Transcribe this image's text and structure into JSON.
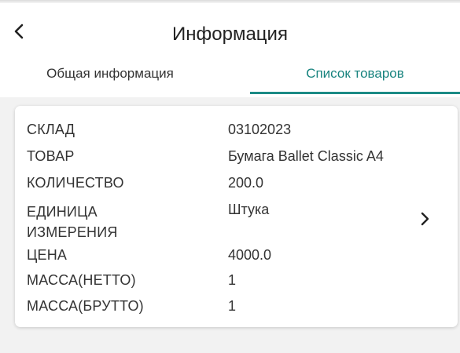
{
  "header": {
    "title": "Информация",
    "back_icon": "chevron-left-icon"
  },
  "tabs": [
    {
      "label": "Общая информация",
      "active": false
    },
    {
      "label": "Список товаров",
      "active": true
    }
  ],
  "colors": {
    "accent": "#1b8a85",
    "background": "#f2f2f2",
    "card": "#ffffff"
  },
  "item": {
    "fields": [
      {
        "label": "СКЛАД",
        "value": "03102023"
      },
      {
        "label": "ТОВАР",
        "value": "Бумага Ballet Classic A4"
      },
      {
        "label": "КОЛИЧЕСТВО",
        "value": "200.0"
      },
      {
        "label": "ЕДИНИЦА ИЗМЕРЕНИЯ",
        "value": "Штука"
      },
      {
        "label": "ЦЕНА",
        "value": "4000.0"
      },
      {
        "label": "МАССА(НЕТТО)",
        "value": "1"
      },
      {
        "label": "МАССА(БРУТТО)",
        "value": "1"
      }
    ],
    "open_icon": "chevron-right-icon"
  }
}
